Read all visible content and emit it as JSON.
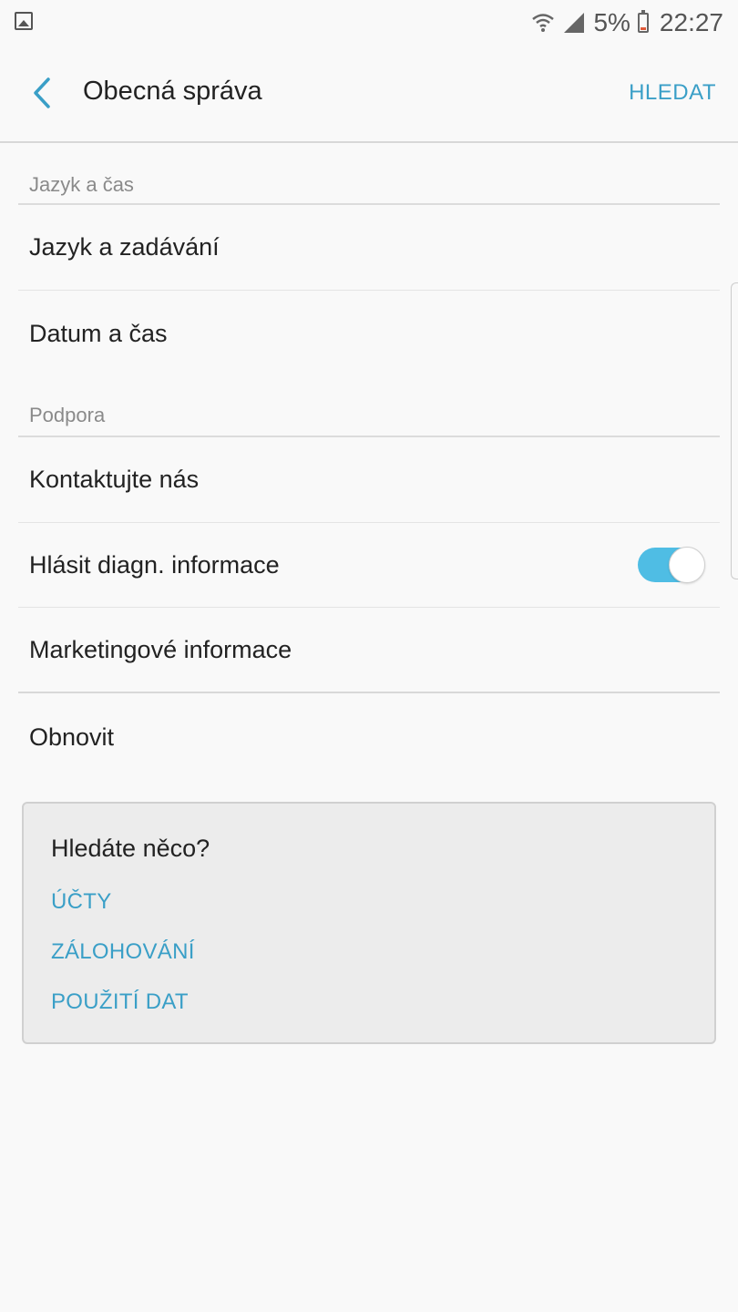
{
  "status_bar": {
    "battery_percent": "5%",
    "time": "22:27",
    "icons": [
      "gallery-icon",
      "wifi-icon",
      "signal-icon",
      "battery-icon"
    ]
  },
  "app_bar": {
    "title": "Obecná správa",
    "search_label": "HLEDAT",
    "back_icon": "chevron-left-icon"
  },
  "sections": [
    {
      "header": "Jazyk a čas",
      "items": [
        {
          "label": "Jazyk a zadávání"
        },
        {
          "label": "Datum a čas"
        }
      ]
    },
    {
      "header": "Podpora",
      "items": [
        {
          "label": "Kontaktujte nás"
        },
        {
          "label": "Hlásit diagn. informace",
          "toggle": true
        },
        {
          "label": "Marketingové informace"
        }
      ]
    }
  ],
  "reset_item": {
    "label": "Obnovit"
  },
  "suggestions": {
    "title": "Hledáte něco?",
    "links": [
      "ÚČTY",
      "ZÁLOHOVÁNÍ",
      "POUŽITÍ DAT"
    ]
  },
  "colors": {
    "accent": "#3a9fc7",
    "toggle_on": "#4fbde4",
    "background": "#f9f9f9"
  }
}
